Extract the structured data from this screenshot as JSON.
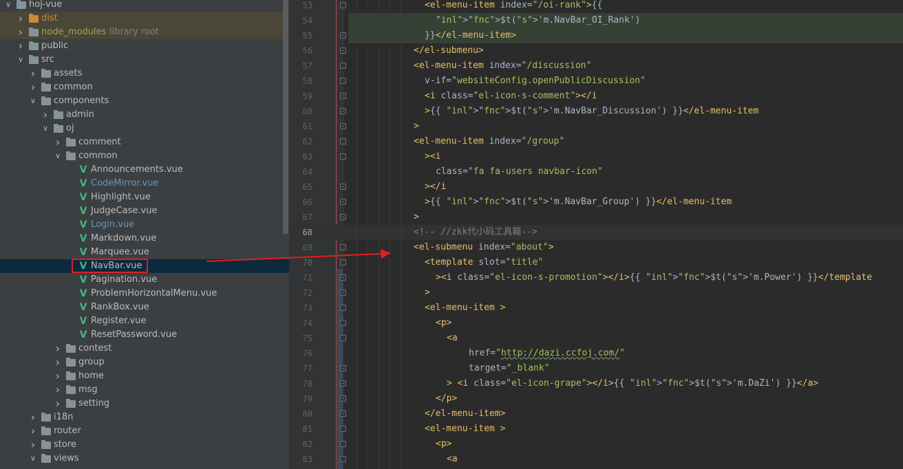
{
  "tree": {
    "rows": [
      {
        "label": "hoj-vue",
        "kind": "folder",
        "depth": 0,
        "open": true,
        "style": "normal"
      },
      {
        "label": "dist",
        "kind": "folder",
        "depth": 1,
        "open": false,
        "style": "excluded-orange"
      },
      {
        "label": "node_modules",
        "extra": "library root",
        "kind": "folder",
        "depth": 1,
        "open": false,
        "style": "excluded-olive"
      },
      {
        "label": "public",
        "kind": "folder",
        "depth": 1,
        "open": false,
        "style": "normal"
      },
      {
        "label": "src",
        "kind": "folder",
        "depth": 1,
        "open": true,
        "style": "normal"
      },
      {
        "label": "assets",
        "kind": "folder",
        "depth": 2,
        "open": false,
        "style": "normal"
      },
      {
        "label": "common",
        "kind": "folder",
        "depth": 2,
        "open": false,
        "style": "normal"
      },
      {
        "label": "components",
        "kind": "folder",
        "depth": 2,
        "open": true,
        "style": "normal"
      },
      {
        "label": "admin",
        "kind": "folder",
        "depth": 3,
        "open": false,
        "style": "normal"
      },
      {
        "label": "oj",
        "kind": "folder",
        "depth": 3,
        "open": true,
        "style": "normal"
      },
      {
        "label": "comment",
        "kind": "folder",
        "depth": 4,
        "open": false,
        "style": "normal"
      },
      {
        "label": "common",
        "kind": "folder",
        "depth": 4,
        "open": true,
        "style": "normal"
      },
      {
        "label": "Announcements.vue",
        "kind": "vue",
        "depth": 5,
        "style": "normal"
      },
      {
        "label": "CodeMirror.vue",
        "kind": "vue",
        "depth": 5,
        "style": "blue"
      },
      {
        "label": "Highlight.vue",
        "kind": "vue",
        "depth": 5,
        "style": "normal"
      },
      {
        "label": "JudgeCase.vue",
        "kind": "vue",
        "depth": 5,
        "style": "normal"
      },
      {
        "label": "Login.vue",
        "kind": "vue",
        "depth": 5,
        "style": "blue"
      },
      {
        "label": "Markdown.vue",
        "kind": "vue",
        "depth": 5,
        "style": "normal"
      },
      {
        "label": "Marquee.vue",
        "kind": "vue",
        "depth": 5,
        "style": "normal"
      },
      {
        "label": "NavBar.vue",
        "kind": "vue",
        "depth": 5,
        "style": "selected"
      },
      {
        "label": "Pagination.vue",
        "kind": "vue",
        "depth": 5,
        "style": "normal"
      },
      {
        "label": "ProblemHorizontalMenu.vue",
        "kind": "vue",
        "depth": 5,
        "style": "normal"
      },
      {
        "label": "RankBox.vue",
        "kind": "vue",
        "depth": 5,
        "style": "normal"
      },
      {
        "label": "Register.vue",
        "kind": "vue",
        "depth": 5,
        "style": "normal"
      },
      {
        "label": "ResetPassword.vue",
        "kind": "vue",
        "depth": 5,
        "style": "normal"
      },
      {
        "label": "contest",
        "kind": "folder",
        "depth": 4,
        "open": false,
        "style": "normal"
      },
      {
        "label": "group",
        "kind": "folder",
        "depth": 4,
        "open": false,
        "style": "normal"
      },
      {
        "label": "home",
        "kind": "folder",
        "depth": 4,
        "open": false,
        "style": "normal"
      },
      {
        "label": "msg",
        "kind": "folder",
        "depth": 4,
        "open": false,
        "style": "normal"
      },
      {
        "label": "setting",
        "kind": "folder",
        "depth": 4,
        "open": false,
        "style": "normal"
      },
      {
        "label": "i18n",
        "kind": "folder",
        "depth": 2,
        "open": false,
        "style": "normal"
      },
      {
        "label": "router",
        "kind": "folder",
        "depth": 2,
        "open": false,
        "style": "normal"
      },
      {
        "label": "store",
        "kind": "folder",
        "depth": 2,
        "open": false,
        "style": "normal"
      },
      {
        "label": "views",
        "kind": "folder",
        "depth": 2,
        "open": true,
        "style": "normal"
      }
    ]
  },
  "editor": {
    "lines": [
      {
        "num": "53",
        "text": "<el-menu-item index=\"/oi-rank\">{{"
      },
      {
        "num": "54",
        "text": "$t('m.NavBar_OI_Rank')"
      },
      {
        "num": "55",
        "text": "}}</el-menu-item>"
      },
      {
        "num": "56",
        "text": "</el-submenu>"
      },
      {
        "num": "57",
        "text": "<el-menu-item index=\"/discussion\""
      },
      {
        "num": "58",
        "text": "v-if=\"websiteConfig.openPublicDiscussion\""
      },
      {
        "num": "59",
        "text": "<i class=\"el-icon-s-comment\"></i"
      },
      {
        "num": "60",
        "text": ">{{ $t('m.NavBar_Discussion') }}</el-menu-item"
      },
      {
        "num": "61",
        "text": ">"
      },
      {
        "num": "62",
        "text": "<el-menu-item index=\"/group\""
      },
      {
        "num": "63",
        "text": "><i"
      },
      {
        "num": "64",
        "text": "class=\"fa fa-users navbar-icon\""
      },
      {
        "num": "65",
        "text": "></i"
      },
      {
        "num": "66",
        "text": ">{{ $t('m.NavBar_Group') }}</el-menu-item"
      },
      {
        "num": "67",
        "text": ">"
      },
      {
        "num": "68",
        "text": "<!-- //zkk代小码工具箱-->"
      },
      {
        "num": "69",
        "text": "<el-submenu index=\"about\">"
      },
      {
        "num": "70",
        "text": "<template slot=\"title\""
      },
      {
        "num": "71",
        "text": "><i class=\"el-icon-s-promotion\"></i>{{ $t('m.Power') }}</template"
      },
      {
        "num": "72",
        "text": ">"
      },
      {
        "num": "73",
        "text": "<el-menu-item >"
      },
      {
        "num": "74",
        "text": "<p>"
      },
      {
        "num": "75",
        "text": "<a"
      },
      {
        "num": "76",
        "text": "href=\"http://dazi.ccfoj.com/\""
      },
      {
        "num": "77",
        "text": "target=\"_blank\""
      },
      {
        "num": "78",
        "text": "> <i class=\"el-icon-grape\"></i>{{ $t('m.DaZi') }}</a>"
      },
      {
        "num": "79",
        "text": "</p>"
      },
      {
        "num": "80",
        "text": "</el-menu-item>"
      },
      {
        "num": "81",
        "text": "<el-menu-item >"
      },
      {
        "num": "82",
        "text": "<p>"
      },
      {
        "num": "83",
        "text": "<a"
      }
    ]
  },
  "colors": {
    "tree_bg": "#3c3f41",
    "editor_bg": "#2b2b2b",
    "selection": "#0d293e",
    "annotation_red": "#e02020",
    "vue_green": "#41b883"
  },
  "icons": [
    "chevron-right-icon",
    "chevron-down-icon",
    "folder-icon",
    "vue-file-icon",
    "fold-marker-icon"
  ]
}
